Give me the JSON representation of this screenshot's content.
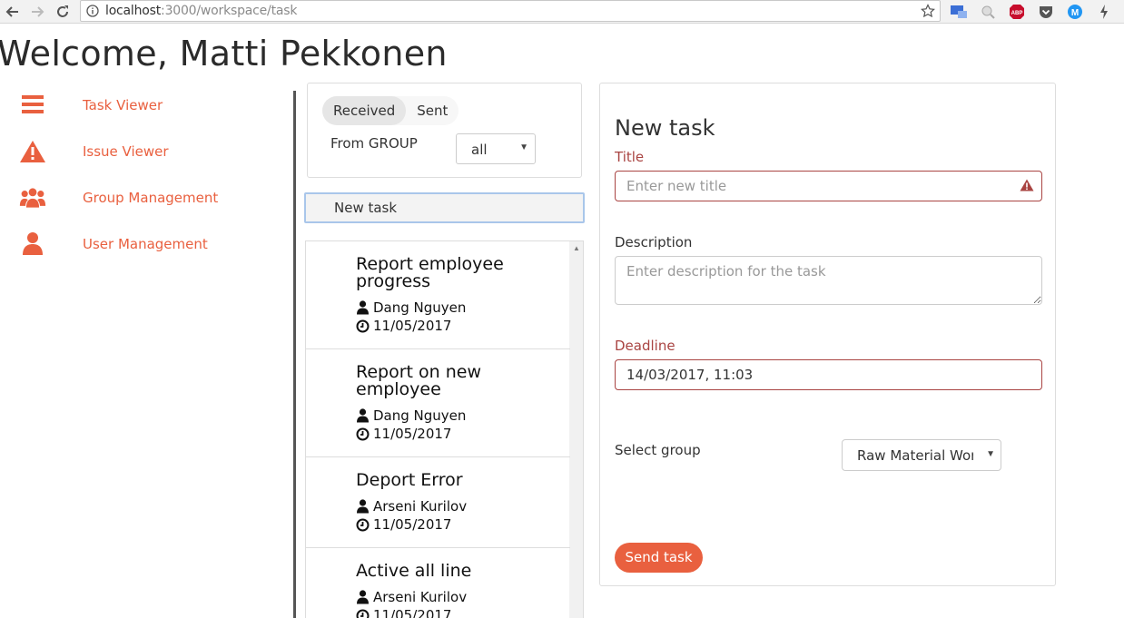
{
  "browser": {
    "url_host": "localhost",
    "url_path": ":3000/workspace/task"
  },
  "header": {
    "welcome": "Welcome, Matti Pekkonen"
  },
  "sidebar": {
    "items": [
      {
        "label": "Task Viewer",
        "icon": "bars-icon"
      },
      {
        "label": "Issue Viewer",
        "icon": "warning-icon"
      },
      {
        "label": "Group Management",
        "icon": "users-icon"
      },
      {
        "label": "User Management",
        "icon": "user-icon"
      }
    ],
    "accent": "#e9603f"
  },
  "filter": {
    "tabs": [
      "Received",
      "Sent"
    ],
    "active_tab": "Received",
    "from_label": "From GROUP",
    "from_value": "all"
  },
  "new_task_button": "New task",
  "tasks": [
    {
      "title": "Report employee progress",
      "author": "Dang Nguyen",
      "date": "11/05/2017"
    },
    {
      "title": "Report on new employee",
      "author": "Dang Nguyen",
      "date": "11/05/2017"
    },
    {
      "title": "Deport Error",
      "author": "Arseni Kurilov",
      "date": "11/05/2017"
    },
    {
      "title": "Active all line",
      "author": "Arseni Kurilov",
      "date": "11/05/2017"
    }
  ],
  "form": {
    "heading": "New task",
    "title_label": "Title",
    "title_placeholder": "Enter new title",
    "description_label": "Description",
    "description_placeholder": "Enter description for the task",
    "deadline_label": "Deadline",
    "deadline_value": "14/03/2017, 11:03",
    "group_label": "Select group",
    "group_value": "Raw Material Wor",
    "send_label": "Send task",
    "error_color": "#a94442"
  }
}
